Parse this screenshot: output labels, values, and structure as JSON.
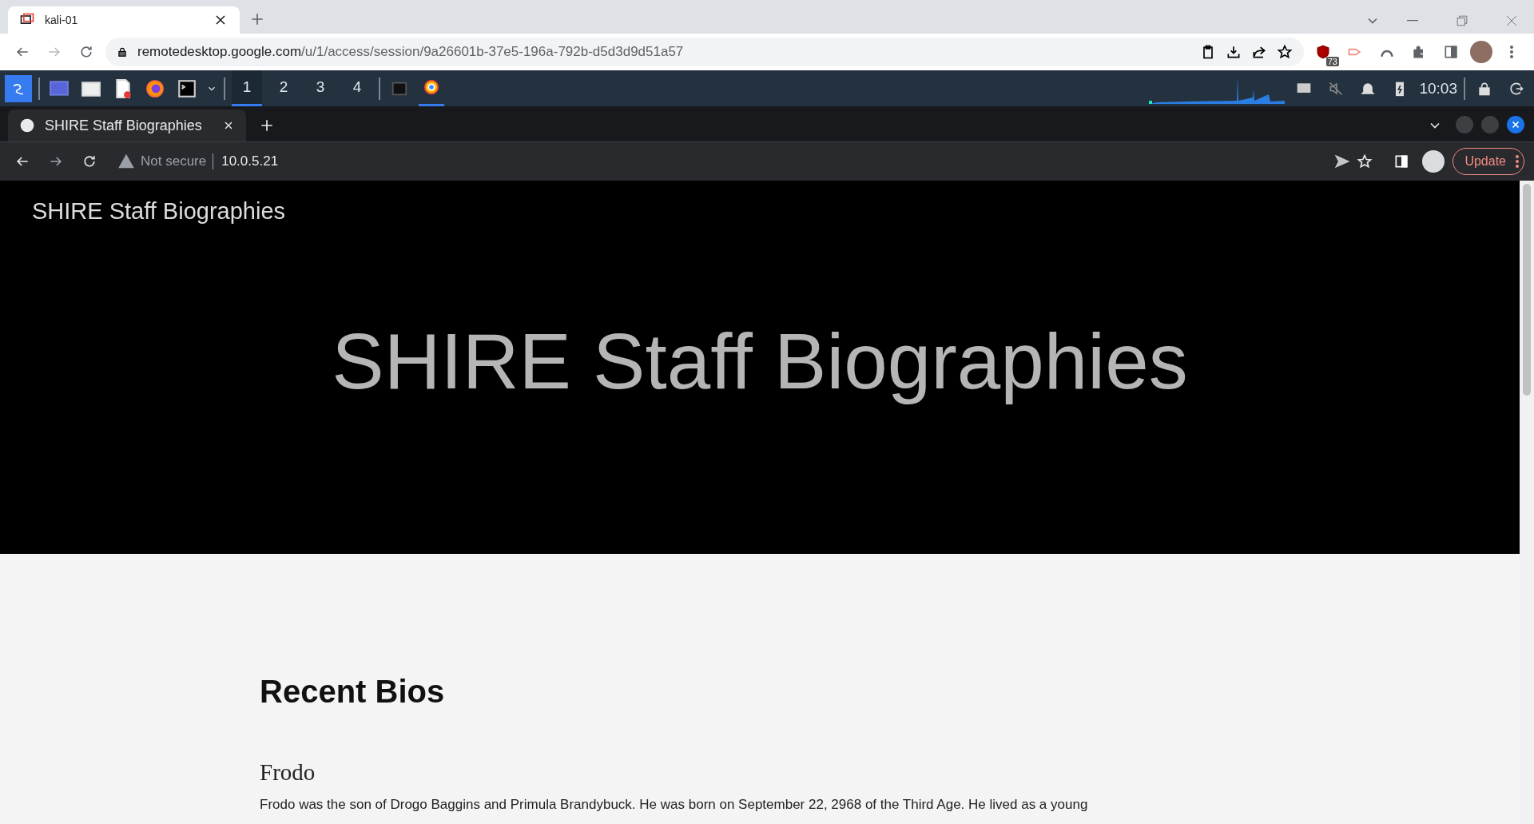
{
  "outer_tabs": [
    {
      "title": "kali-01",
      "selected": true
    }
  ],
  "outer_address": {
    "url_host": "remotedesktop.google.com",
    "url_path": "/u/1/access/session/9a26601b-37e5-196a-792b-d5d3d9d51a57"
  },
  "extension_badge": "73",
  "panel": {
    "workspaces": [
      {
        "label": "1",
        "selected": true
      },
      {
        "label": "2",
        "selected": false
      },
      {
        "label": "3",
        "selected": false
      },
      {
        "label": "4",
        "selected": false
      }
    ],
    "clock": "10:03"
  },
  "inner_tabs": [
    {
      "title": "SHIRE Staff Biographies",
      "selected": true
    }
  ],
  "inner_address": {
    "security": "Not secure",
    "url": "10.0.5.21"
  },
  "update_button": "Update",
  "page": {
    "nav_title": "SHIRE Staff Biographies",
    "hero_title": "SHIRE Staff Biographies",
    "section_title": "Recent Bios",
    "bios": [
      {
        "name": "Frodo",
        "text": "Frodo was the son of Drogo Baggins and Primula Brandybuck. He was born on September 22, 2968 of the Third Age. He lived as a young"
      }
    ]
  }
}
